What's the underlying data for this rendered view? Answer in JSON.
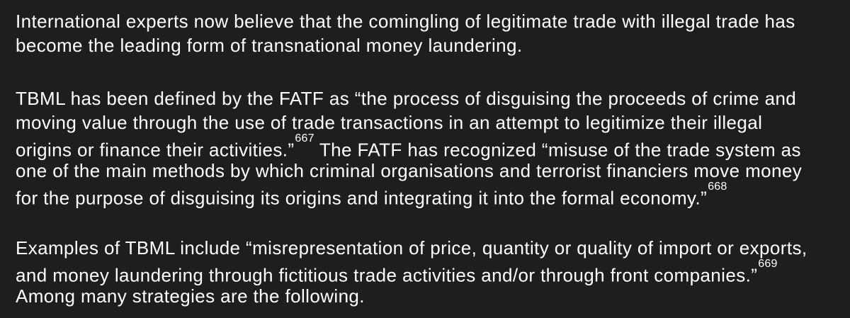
{
  "colors": {
    "background": "#1e1e1e",
    "text": "#ffffff"
  },
  "paragraphs": [
    {
      "lines": [
        {
          "text": "International experts now believe that the comingling of legitimate trade with illegal trade has"
        },
        {
          "text": "become the leading form of transnational money laundering."
        }
      ]
    },
    {
      "lines": [
        {
          "text": "TBML has been defined by the FATF as “the process of disguising the proceeds of crime and"
        },
        {
          "text": "moving value through the use of trade transactions in an attempt to legitimize their illegal"
        },
        {
          "text": "origins or finance their activities.”",
          "footnote": "667",
          "after": " The FATF has recognized “misuse of the trade system as"
        },
        {
          "text": "one of the main methods by which criminal organisations and terrorist financiers move money"
        },
        {
          "text": "for the purpose of disguising its origins and integrating it into the formal economy.”",
          "footnote": "668"
        }
      ]
    },
    {
      "lines": [
        {
          "text": "Examples of TBML include “misrepresentation of price, quantity or quality of import or exports,"
        },
        {
          "text": "and money laundering through fictitious trade activities and/or through front companies.”",
          "footnote": "669"
        },
        {
          "text": "Among many strategies are the following."
        }
      ]
    }
  ]
}
